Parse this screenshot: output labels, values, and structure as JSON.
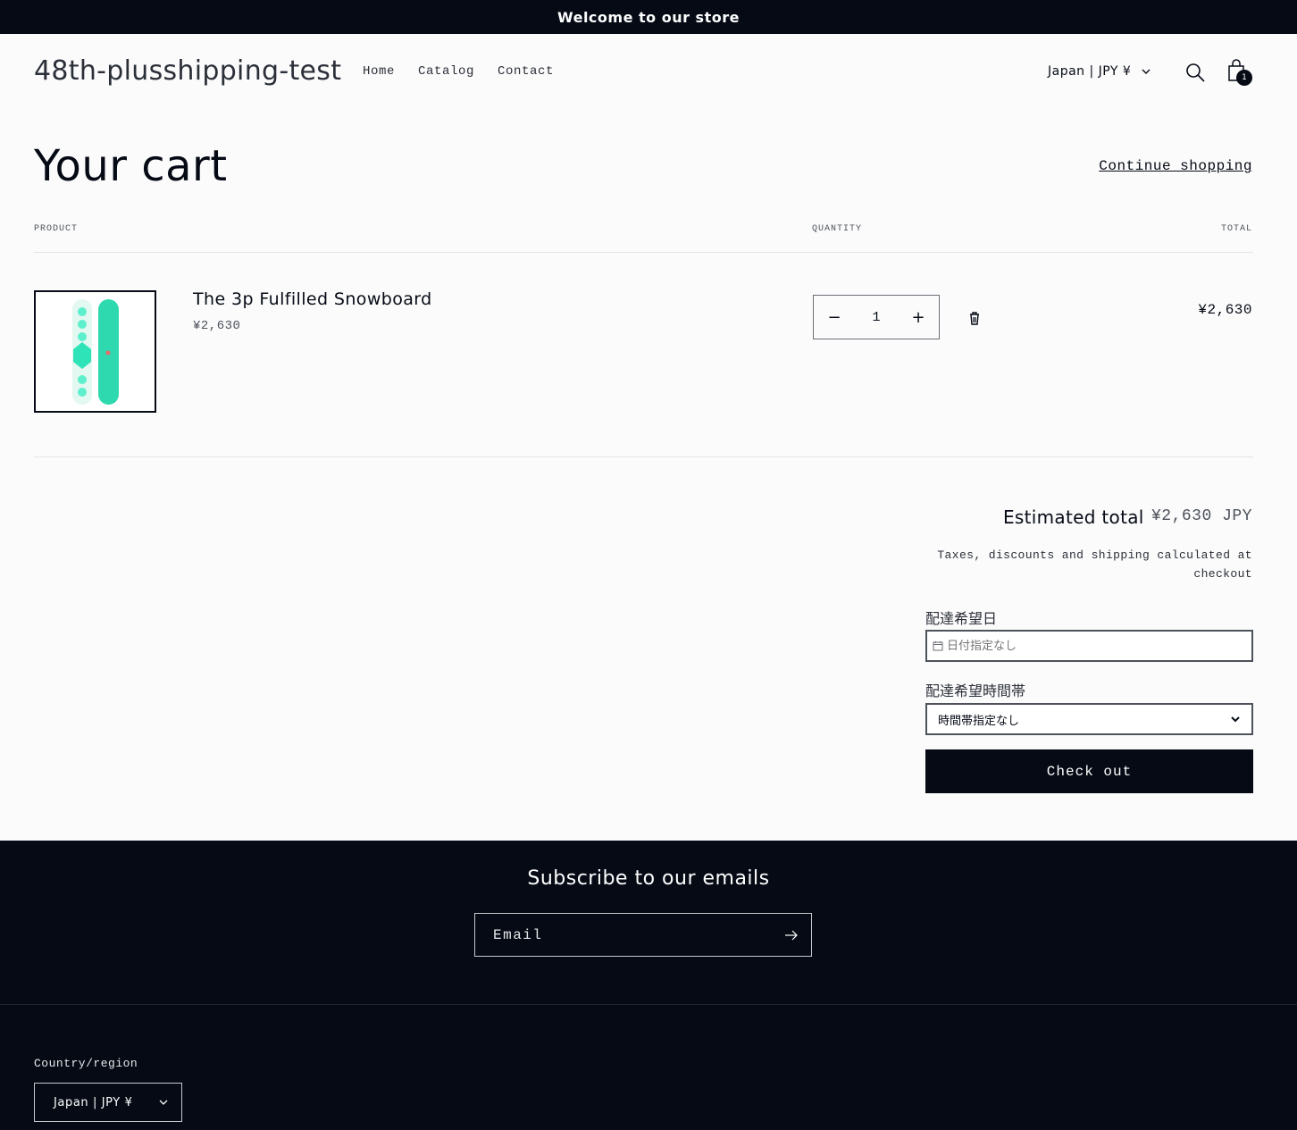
{
  "announcement": {
    "text": "Welcome to our store"
  },
  "header": {
    "logo": "48th-plusshipping-test",
    "nav": [
      "Home",
      "Catalog",
      "Contact"
    ],
    "localization": "Japan | JPY ¥",
    "cart_count": "1",
    "icons": [
      "search-icon",
      "cart-icon",
      "chevron-down-icon"
    ]
  },
  "cart": {
    "title": "Your cart",
    "continue_label": "Continue shopping",
    "columns": {
      "product": "PRODUCT",
      "quantity": "QUANTITY",
      "total": "TOTAL"
    },
    "items": [
      {
        "title": "The 3p Fulfilled Snowboard",
        "price": "¥2,630",
        "quantity": "1",
        "line_total": "¥2,630"
      }
    ]
  },
  "totals": {
    "estimated_label": "Estimated total",
    "estimated_value": "¥2,630 JPY",
    "tax_note": "Taxes, discounts and shipping calculated at checkout"
  },
  "delivery": {
    "date_label": "配達希望日",
    "date_placeholder": "日付指定なし",
    "time_label": "配達希望時間帯",
    "time_selected": "時間帯指定なし"
  },
  "checkout_label": "Check out",
  "footer": {
    "subscribe_title": "Subscribe to our emails",
    "email_placeholder": "Email",
    "country_label": "Country/region",
    "country_value": "Japan | JPY ¥"
  },
  "colors": {
    "dark": "#050a15",
    "background": "#fbfbfb",
    "snowboard_teal": "#2fd9b0"
  }
}
